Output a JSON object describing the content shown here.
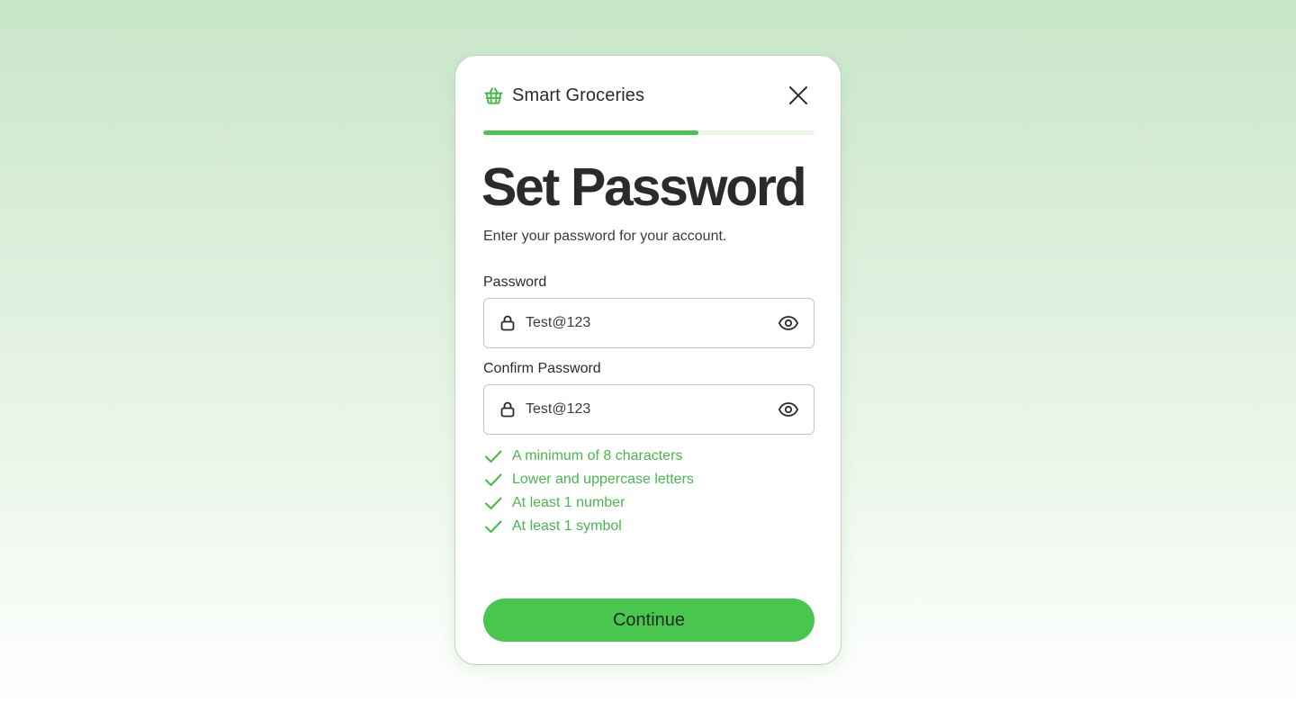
{
  "brand": {
    "name": "Smart Groceries",
    "icon": "basket-icon",
    "color": "#45b94a"
  },
  "header": {
    "close_icon": "close-icon"
  },
  "progress": {
    "fraction": 0.65,
    "track_color": "#e8f5e7",
    "fill_color": "#4cc24f"
  },
  "main": {
    "title": "Set Password",
    "subtitle": "Enter your password for your account."
  },
  "form": {
    "password": {
      "label": "Password",
      "value": "Test@123",
      "lead_icon": "lock-icon",
      "trail_icon": "eye-icon"
    },
    "confirm_password": {
      "label": "Confirm Password",
      "value": "Test@123",
      "lead_icon": "lock-icon",
      "trail_icon": "eye-icon"
    }
  },
  "requirements": {
    "icon": "check-icon",
    "color": "#45b94a",
    "items": [
      {
        "label": "A minimum of 8 characters",
        "met": true
      },
      {
        "label": "Lower and uppercase letters",
        "met": true
      },
      {
        "label": "At least 1 number",
        "met": true
      },
      {
        "label": "At least 1 symbol",
        "met": true
      }
    ]
  },
  "actions": {
    "continue_label": "Continue",
    "button_color": "#49c64d"
  }
}
